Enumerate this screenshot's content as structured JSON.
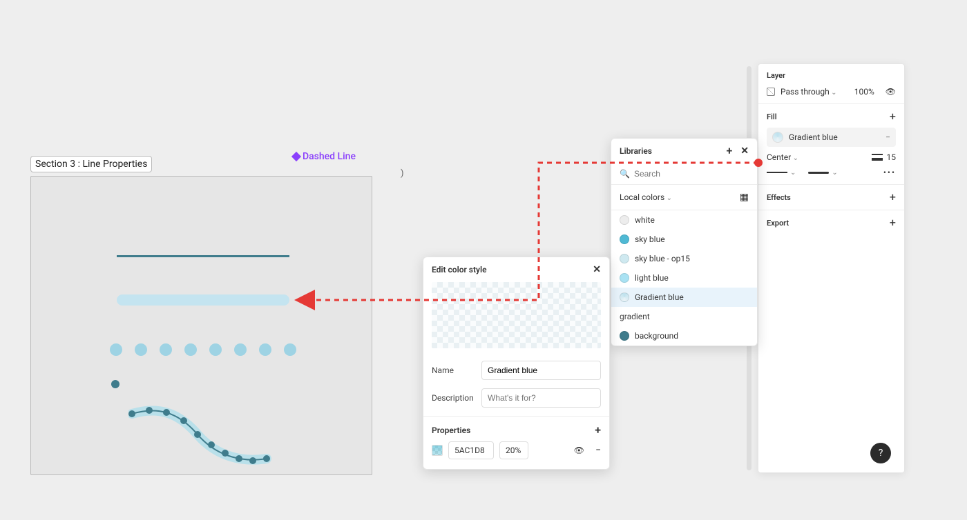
{
  "canvas": {
    "section_label": "Section 3 : Line Properties",
    "selected_layer_tag": "Dashed Line"
  },
  "edit_style": {
    "title": "Edit color style",
    "name_label": "Name",
    "name_value": "Gradient blue",
    "description_label": "Description",
    "description_placeholder": "What's it for?",
    "properties_header": "Properties",
    "hex": "5AC1D8",
    "opacity": "20%"
  },
  "libraries": {
    "title": "Libraries",
    "search_placeholder": "Search",
    "local_group": "Local colors",
    "items": [
      {
        "label": "white",
        "color": "#ededed",
        "selected": false
      },
      {
        "label": "sky blue",
        "color": "#4fb9d4",
        "selected": false
      },
      {
        "label": "sky blue - op15",
        "color": "#cfe9f0",
        "selected": false
      },
      {
        "label": "light blue",
        "color": "#a9e2f3",
        "selected": false
      },
      {
        "label": "Gradient blue",
        "color": "gradient",
        "selected": true
      }
    ],
    "second_group": "gradient",
    "second_items": [
      {
        "label": "background",
        "color": "#3f7c8c"
      }
    ]
  },
  "right_panel": {
    "layer_section": "Layer",
    "blend_mode": "Pass through",
    "opacity": "100%",
    "fill_section": "Fill",
    "fill_style_name": "Gradient blue",
    "stroke_align": "Center",
    "stroke_weight": "15",
    "effects_section": "Effects",
    "export_section": "Export"
  },
  "help": "?"
}
